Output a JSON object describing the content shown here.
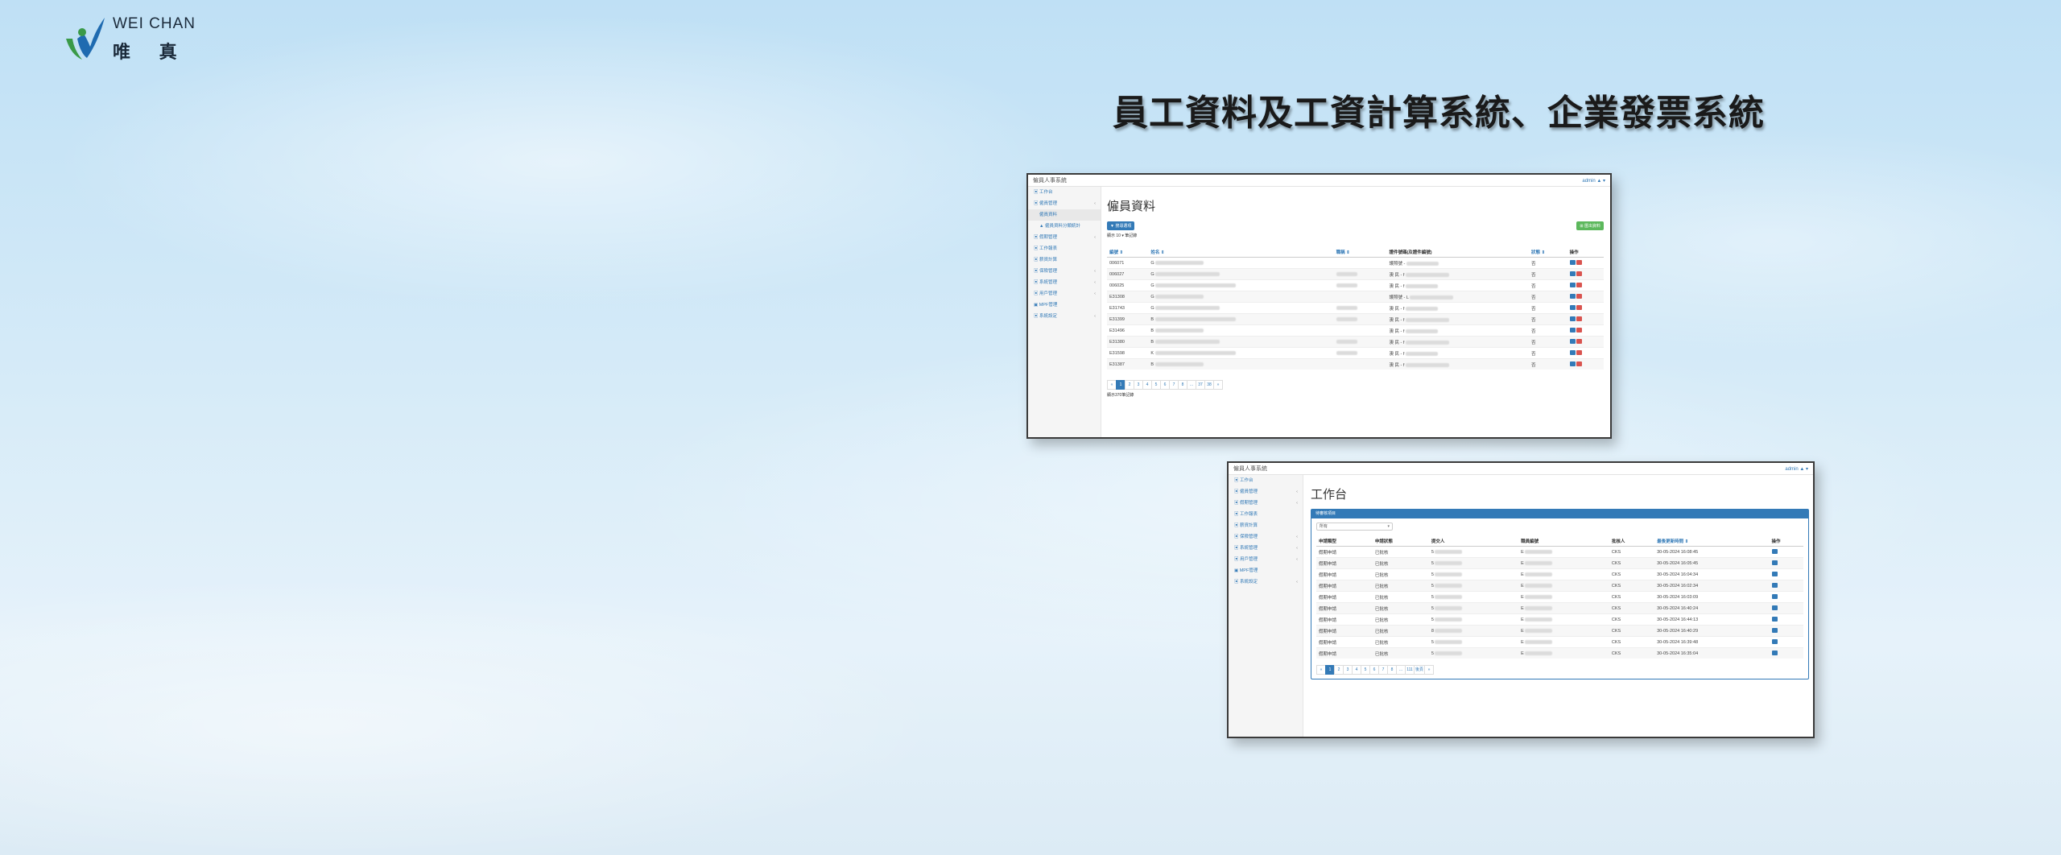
{
  "brand": {
    "name_en": "WEI CHAN",
    "name_zh": "唯 真",
    "colors": {
      "green": "#3a9a48",
      "blue": "#1f6bb0"
    }
  },
  "headline": "員工資料及工資計算系統、企業發票系統",
  "window1": {
    "app_title": "僱員人事系統",
    "user": "admin ▲ ▾",
    "sidebar": [
      {
        "label": "工作台",
        "icon": "dashboard-icon"
      },
      {
        "label": "僱員管理",
        "icon": "users-icon",
        "chevron": "‹"
      },
      {
        "label": "僱員資料",
        "icon": "",
        "sub": true,
        "active": true
      },
      {
        "label": "▲ 僱員資料分類統計",
        "icon": "",
        "sub": true
      },
      {
        "label": "假期管理",
        "icon": "calendar-icon",
        "chevron": "‹"
      },
      {
        "label": "工作報表",
        "icon": "report-icon"
      },
      {
        "label": "薪資計算",
        "icon": "money-icon"
      },
      {
        "label": "保險管理",
        "icon": "shield-icon",
        "chevron": "‹"
      },
      {
        "label": "系統管理",
        "icon": "gear-icon",
        "chevron": "‹"
      },
      {
        "label": "用戶管理",
        "icon": "user-icon",
        "chevron": "‹"
      },
      {
        "label": "MPF管理",
        "icon": "list-icon"
      },
      {
        "label": "系統設定",
        "icon": "wrench-icon",
        "chevron": "‹"
      }
    ],
    "page_title": "僱員資料",
    "add_button": "▼ 搜尋選項",
    "export_button": "⊞ 匯出資料",
    "page_size_text": "顯示 10 ▾ 筆記錄",
    "columns": [
      "編號 ⇕",
      "姓名 ⇕",
      "職稱 ⇕",
      "證件號碼(及證件編號)",
      "狀態 ⇕",
      "操作"
    ],
    "rows": [
      {
        "id": "006071",
        "name": "G",
        "status": "否",
        "id_prefix": "護照號 -"
      },
      {
        "id": "006027",
        "name": "G",
        "status": "否",
        "id_prefix": "澳 民 - f"
      },
      {
        "id": "006025",
        "name": "G",
        "status": "否",
        "id_prefix": "澳 民 - f"
      },
      {
        "id": "E31308",
        "name": "G",
        "status": "否",
        "id_prefix": "護照號 - L"
      },
      {
        "id": "E31743",
        "name": "G",
        "status": "否",
        "id_prefix": "澳 民 - f"
      },
      {
        "id": "E31399",
        "name": "B",
        "status": "否",
        "id_prefix": "澳 民 - f"
      },
      {
        "id": "E31496",
        "name": "B",
        "status": "否",
        "id_prefix": "澳 民 - f"
      },
      {
        "id": "E31380",
        "name": "B",
        "status": "否",
        "id_prefix": "澳 民 - f"
      },
      {
        "id": "E31598",
        "name": "K",
        "status": "否",
        "id_prefix": "澳 民 - f"
      },
      {
        "id": "E31387",
        "name": "B",
        "status": "否",
        "id_prefix": "澳 民 - f"
      }
    ],
    "pages": [
      "«",
      "1",
      "2",
      "3",
      "4",
      "5",
      "6",
      "7",
      "8",
      "…",
      "37",
      "38",
      "»"
    ],
    "summary": "顯示370筆記錄"
  },
  "window2": {
    "app_title": "僱員人事系統",
    "user": "admin ▲ ▾",
    "sidebar": [
      {
        "label": "工作台",
        "icon": "dashboard-icon"
      },
      {
        "label": "僱員管理",
        "icon": "users-icon",
        "chevron": "‹"
      },
      {
        "label": "假期管理",
        "icon": "calendar-icon",
        "chevron": "‹"
      },
      {
        "label": "工作報表",
        "icon": "report-icon"
      },
      {
        "label": "薪資計算",
        "icon": "money-icon"
      },
      {
        "label": "保險管理",
        "icon": "shield-icon",
        "chevron": "‹"
      },
      {
        "label": "系統管理",
        "icon": "gear-icon",
        "chevron": "‹"
      },
      {
        "label": "用戶管理",
        "icon": "user-icon",
        "chevron": "‹"
      },
      {
        "label": "MPF管理",
        "icon": "list-icon"
      },
      {
        "label": "系統設定",
        "icon": "wrench-icon",
        "chevron": "‹"
      }
    ],
    "page_title": "工作台",
    "panel_title": "待審核項目",
    "filter_value": "所有",
    "columns": [
      "申請類型",
      "申請狀態",
      "提交人",
      "職員編號",
      "批核人",
      "最後更新時間 ⇕",
      "操作"
    ],
    "rows": [
      {
        "type": "假期申請",
        "state": "已批核",
        "submitter": "5",
        "staff": "E",
        "approver": "CKS",
        "updated": "30-05-2024 16:08:45"
      },
      {
        "type": "假期申請",
        "state": "已批核",
        "submitter": "5",
        "staff": "E",
        "approver": "CKS",
        "updated": "30-05-2024 16:05:45"
      },
      {
        "type": "假期申請",
        "state": "已批核",
        "submitter": "5",
        "staff": "E",
        "approver": "CKS",
        "updated": "30-05-2024 16:04:34"
      },
      {
        "type": "假期申請",
        "state": "已批核",
        "submitter": "5",
        "staff": "E",
        "approver": "CKS",
        "updated": "30-05-2024 16:02:34"
      },
      {
        "type": "假期申請",
        "state": "已批核",
        "submitter": "5",
        "staff": "E",
        "approver": "CKS",
        "updated": "30-05-2024 16:03:09"
      },
      {
        "type": "假期申請",
        "state": "已批核",
        "submitter": "5",
        "staff": "E",
        "approver": "CKS",
        "updated": "30-05-2024 16:40:24"
      },
      {
        "type": "假期申請",
        "state": "已批核",
        "submitter": "5",
        "staff": "E",
        "approver": "CKS",
        "updated": "30-05-2024 16:44:13"
      },
      {
        "type": "假期申請",
        "state": "已批核",
        "submitter": "8",
        "staff": "E",
        "approver": "CKS",
        "updated": "30-05-2024 16:40:29"
      },
      {
        "type": "假期申請",
        "state": "已批核",
        "submitter": "5",
        "staff": "E",
        "approver": "CKS",
        "updated": "30-05-2024 16:39:48"
      },
      {
        "type": "假期申請",
        "state": "已批核",
        "submitter": "5",
        "staff": "E",
        "approver": "CKS",
        "updated": "30-05-2024 16:35:04"
      }
    ],
    "pages": [
      "«",
      "1",
      "2",
      "3",
      "4",
      "5",
      "6",
      "7",
      "8",
      "…",
      "111",
      "後頁",
      "»"
    ]
  }
}
